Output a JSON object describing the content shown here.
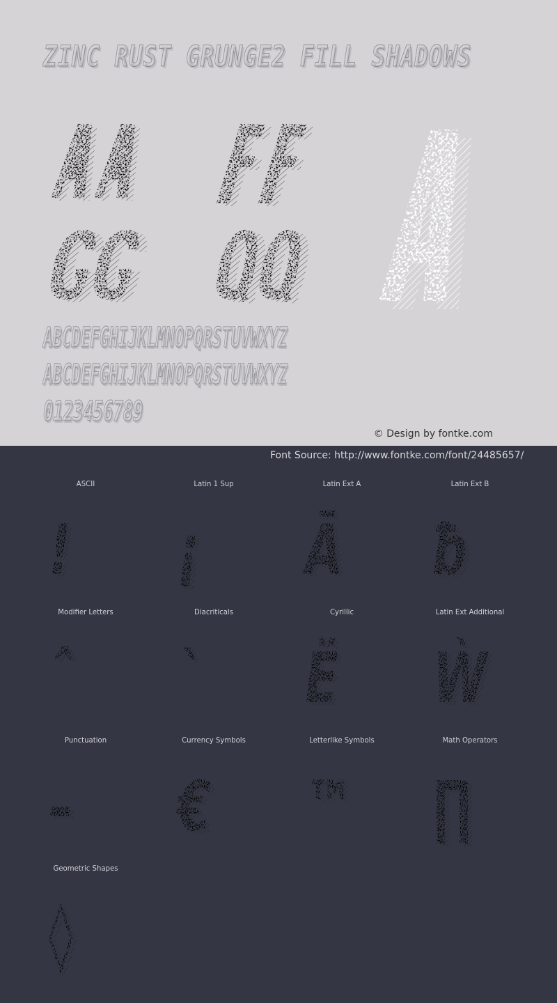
{
  "header": {
    "font_name": "ZINC RUST GRUNGE2 FILL SHADOWS"
  },
  "preview": {
    "pairs": [
      {
        "label": "Aa"
      },
      {
        "label": "Ff"
      },
      {
        "label": "Gg"
      },
      {
        "label": "Qq"
      }
    ],
    "large_glyph": "A",
    "uppercase": "ABCDEFGHIJKLMNOPQRSTUVWXYZ",
    "lowercase": "ABCDEFGHIJKLMNOPQRSTUVWXYZ",
    "digits": "0123456789"
  },
  "credit": "© Design by fontke.com",
  "source": "Font Source: http://www.fontke.com/font/24485657/",
  "blocks": [
    {
      "label": "ASCII",
      "glyph": "!"
    },
    {
      "label": "Latin 1 Sup",
      "glyph": "¡"
    },
    {
      "label": "Latin Ext A",
      "glyph": "Ā"
    },
    {
      "label": "Latin Ext B",
      "glyph": "ƀ"
    },
    {
      "label": "Modifier Letters",
      "glyph": "ˆ"
    },
    {
      "label": "Diacriticals",
      "glyph": "`"
    },
    {
      "label": "Cyrillic",
      "glyph": "Ё"
    },
    {
      "label": "Latin Ext Additional",
      "glyph": "Ẁ"
    },
    {
      "label": "Punctuation",
      "glyph": "–"
    },
    {
      "label": "Currency Symbols",
      "glyph": "€"
    },
    {
      "label": "Letterlike Symbols",
      "glyph": "™"
    },
    {
      "label": "Math Operators",
      "glyph": "∏"
    },
    {
      "label": "Geometric Shapes",
      "glyph": "◊"
    }
  ]
}
